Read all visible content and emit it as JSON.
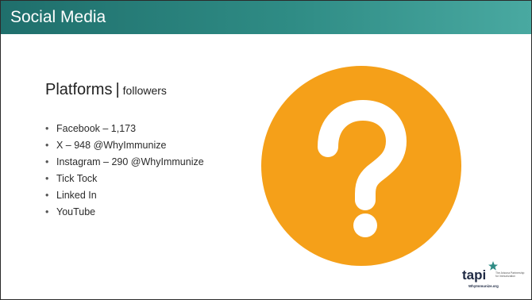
{
  "slide": {
    "title": "Social Media",
    "subtitle": {
      "main": "Platforms",
      "separator": "|",
      "detail": "followers"
    },
    "bullets": [
      {
        "text": "Facebook – 1,173"
      },
      {
        "text": "X – 948 @WhyImmunize"
      },
      {
        "text": "Instagram – 290 @WhyImmunize"
      },
      {
        "text": "Tick Tock"
      },
      {
        "text": "Linked In"
      },
      {
        "text": "YouTube"
      }
    ],
    "bullet_glyph": "•"
  },
  "graphic": {
    "icon": "question-mark-icon",
    "color": "#F5A019"
  },
  "logo": {
    "wordmark": "tapi",
    "tagline_line1": "The Arizona Partnership",
    "tagline_line2": "for Immunization",
    "url": "WhyImmunize.org"
  },
  "colors": {
    "title_bar": "#2f8c85",
    "accent": "#F5A019"
  }
}
